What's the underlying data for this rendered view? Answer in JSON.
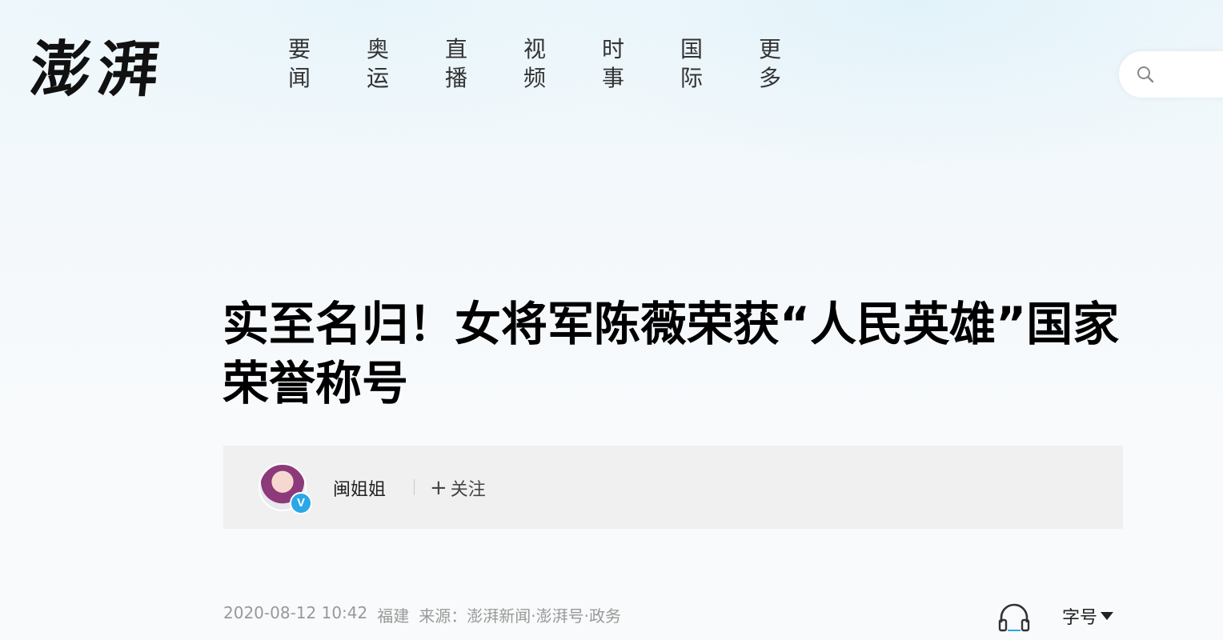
{
  "header": {
    "logo_text": "澎湃",
    "nav": [
      {
        "line1": "要",
        "line2": "闻"
      },
      {
        "line1": "奥",
        "line2": "运"
      },
      {
        "line1": "直",
        "line2": "播"
      },
      {
        "line1": "视",
        "line2": "频"
      },
      {
        "line1": "时",
        "line2": "事"
      },
      {
        "line1": "国",
        "line2": "际"
      },
      {
        "line1": "更",
        "line2": "多"
      }
    ],
    "search": {
      "icon": "search-icon",
      "placeholder": ""
    }
  },
  "article": {
    "title": "实至名归！女将军陈薇荣获“人民英雄”国家荣誉称号",
    "author": {
      "name": "闽姐姐",
      "verified_badge": "V",
      "follow_label": "关注",
      "follow_icon": "plus-icon"
    },
    "meta": {
      "datetime": "2020-08-12 10:42",
      "location": "福建",
      "source": "来源：澎湃新闻·澎湃号·政务"
    },
    "tools": {
      "audio_icon": "headphones-icon",
      "font_size_label": "字号"
    }
  },
  "colors": {
    "title": "#000000",
    "nav_text": "#333333",
    "meta_text": "#999999",
    "author_bar_bg": "#f0f0f0",
    "badge": "#2aa7e8"
  }
}
